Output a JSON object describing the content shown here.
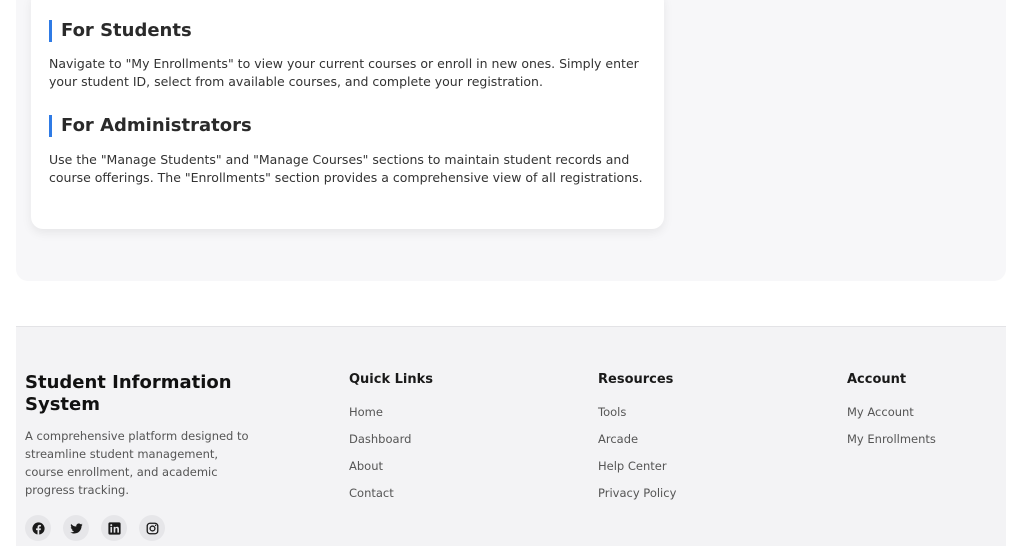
{
  "guide": {
    "students_title": "For Students",
    "students_text": "Navigate to \"My Enrollments\" to view your current courses or enroll in new ones. Simply enter your student ID, select from available courses, and complete your registration.",
    "admins_title": "For Administrators",
    "admins_text": "Use the \"Manage Students\" and \"Manage Courses\" sections to maintain student records and course offerings. The \"Enrollments\" section provides a comprehensive view of all registrations."
  },
  "footer": {
    "brand_title": "Student Information System",
    "brand_desc": "A comprehensive platform designed to streamline student management, course enrollment, and academic progress tracking.",
    "socials": [
      "facebook-icon",
      "twitter-icon",
      "linkedin-icon",
      "instagram-icon"
    ],
    "quick_links": {
      "title": "Quick Links",
      "items": [
        "Home",
        "Dashboard",
        "About",
        "Contact"
      ]
    },
    "resources": {
      "title": "Resources",
      "items": [
        "Tools",
        "Arcade",
        "Help Center",
        "Privacy Policy"
      ]
    },
    "account": {
      "title": "Account",
      "items": [
        "My Account",
        "My Enrollments"
      ]
    }
  },
  "colors": {
    "accent": "#2f7be5",
    "footer_bg": "#f3f3f5",
    "section_bg": "#f7f7f9"
  }
}
